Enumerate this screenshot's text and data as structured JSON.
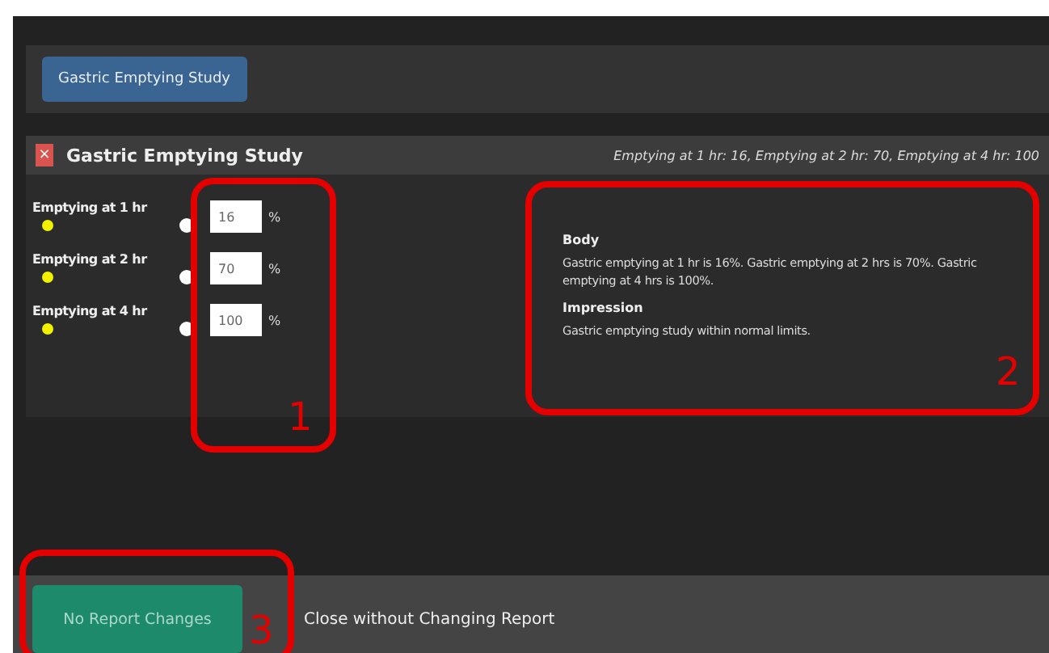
{
  "toolbar": {
    "study_button": "Gastric Emptying Study"
  },
  "section": {
    "title": "Gastric Emptying Study",
    "close_icon": "×",
    "summary": "Emptying at 1 hr: 16, Emptying at 2 hr: 70, Emptying at 4 hr: 100"
  },
  "measurements": [
    {
      "label": "Emptying at 1 hr",
      "value": "16",
      "unit": "%"
    },
    {
      "label": "Emptying at 2 hr",
      "value": "70",
      "unit": "%"
    },
    {
      "label": "Emptying at 4 hr",
      "value": "100",
      "unit": "%"
    }
  ],
  "report": [
    {
      "heading": "Body",
      "text": "Gastric emptying at 1 hr is 16%. Gastric emptying at 2 hrs is 70%. Gastric emptying at 4 hrs is 100%."
    },
    {
      "heading": "Impression",
      "text": "Gastric emptying study within normal limits."
    }
  ],
  "footer": {
    "primary_button": "No Report Changes",
    "secondary_button": "Close without Changing Report"
  },
  "annotations": [
    "1",
    "2",
    "3"
  ]
}
